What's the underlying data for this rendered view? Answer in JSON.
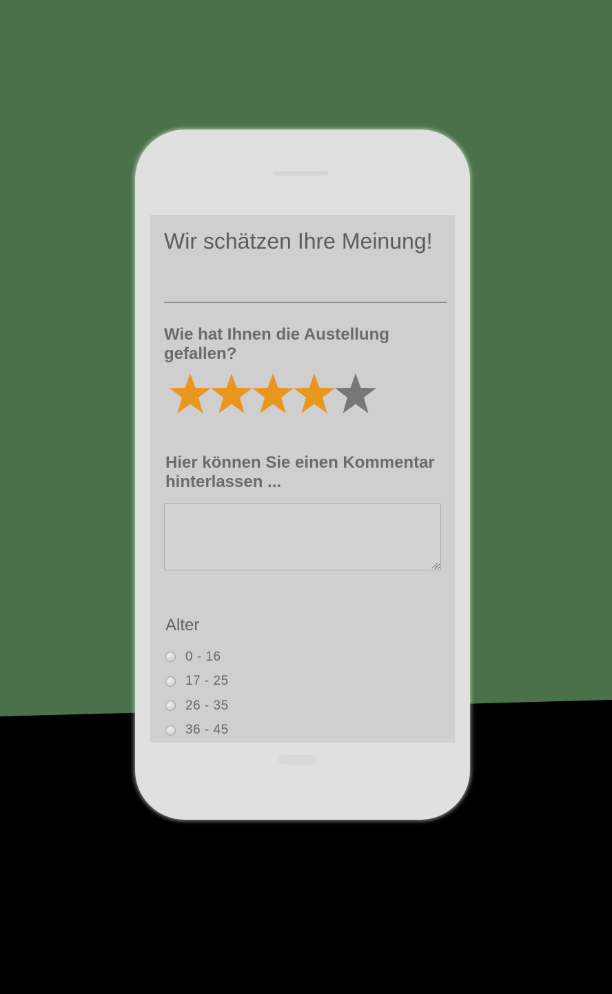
{
  "survey": {
    "title": "Wir schätzen Ihre Meinung!",
    "rating": {
      "question": "Wie hat Ihnen die Austellung gefallen?",
      "value": 4,
      "max": 5,
      "filled_color": "#e8961e",
      "empty_color": "#777777",
      "icon": "star-icon"
    },
    "comment": {
      "label": "Hier können Sie einen Kommentar hinterlassen ...",
      "value": "",
      "placeholder": ""
    },
    "age": {
      "label": "Alter",
      "options": [
        {
          "label": "0 - 16",
          "selected": false
        },
        {
          "label": "17 - 25",
          "selected": false
        },
        {
          "label": "26 - 35",
          "selected": false
        },
        {
          "label": "36 - 45",
          "selected": false
        }
      ]
    }
  }
}
